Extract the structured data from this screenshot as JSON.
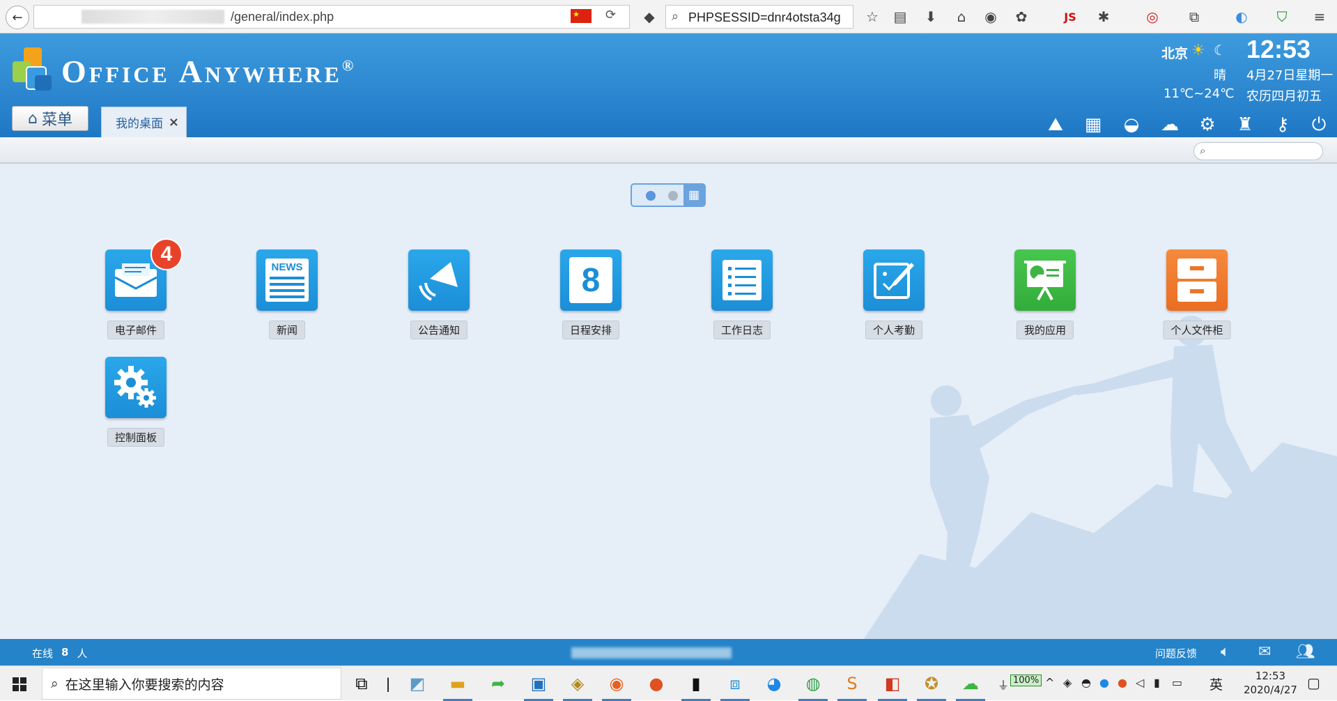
{
  "browser": {
    "url_visible": "/general/index.php",
    "search_query": "PHPSESSID=dnr4otsta34g",
    "js_label": "JS"
  },
  "header": {
    "logo_text": "Office Anywhere",
    "logo_reg": "®",
    "weather": {
      "city": "北京",
      "condition": "晴",
      "temp": "11℃~24℃"
    },
    "clock": {
      "time": "12:53",
      "date": "4月27日星期一",
      "lunar": "农历四月初五"
    },
    "menu_label": "菜单",
    "tabs": [
      {
        "label": "我的桌面",
        "close": "×"
      }
    ]
  },
  "desktop": {
    "apps": [
      {
        "label": "电子邮件",
        "badge": "4"
      },
      {
        "label": "新闻",
        "icon_text": "NEWS"
      },
      {
        "label": "公告通知"
      },
      {
        "label": "日程安排",
        "icon_text": "8"
      },
      {
        "label": "工作日志"
      },
      {
        "label": "个人考勤"
      },
      {
        "label": "我的应用"
      },
      {
        "label": "个人文件柜"
      },
      {
        "label": "控制面板"
      }
    ]
  },
  "status": {
    "online_prefix": "在线",
    "online_count": "8",
    "online_suffix": "人",
    "feedback": "问题反馈"
  },
  "taskbar": {
    "search_placeholder": "在这里输入你要搜索的内容",
    "battery": "100%",
    "ime": "英",
    "time": "12:53",
    "date": "2020/4/27"
  },
  "colors": {
    "header_blue": "#2c86cf",
    "desktop_bg": "#e6eef8",
    "badge_red": "#e8432a",
    "accent_green": "#3db544",
    "accent_orange": "#ee7428"
  }
}
